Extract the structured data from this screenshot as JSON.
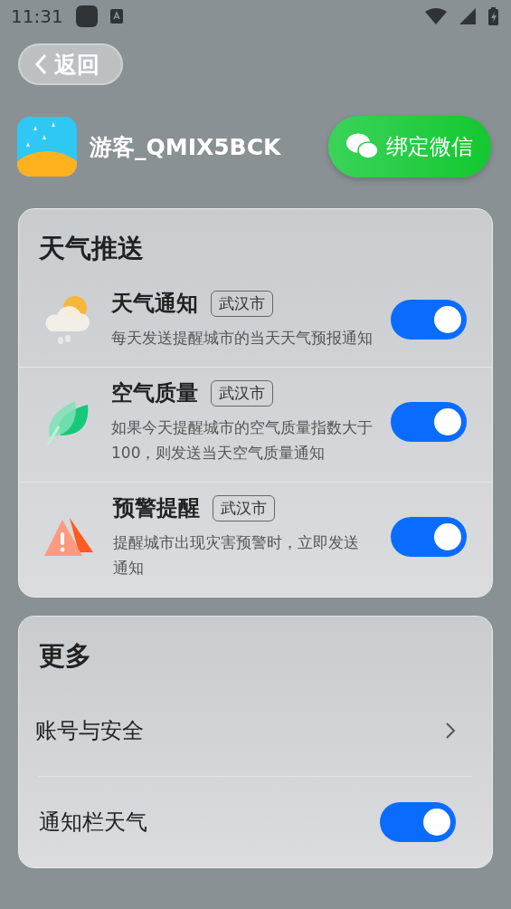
{
  "status_bar": {
    "time": "11:31"
  },
  "back_button": {
    "label": "返回"
  },
  "profile": {
    "name": "游客_QMIX5BCK",
    "bind_button": "绑定微信"
  },
  "weather_push": {
    "title": "天气推送",
    "items": [
      {
        "kind": "weather",
        "title": "天气通知",
        "city": "武汉市",
        "description": "每天发送提醒城市的当天天气预报通知",
        "on": true
      },
      {
        "kind": "air",
        "title": "空气质量",
        "city": "武汉市",
        "description": "如果今天提醒城市的空气质量指数大于100，则发送当天空气质量通知",
        "on": true
      },
      {
        "kind": "alert",
        "title": "预警提醒",
        "city": "武汉市",
        "description": "提醒城市出现灾害预警时，立即发送通知",
        "on": true
      }
    ]
  },
  "more": {
    "title": "更多",
    "items": [
      {
        "kind": "link",
        "label": "账号与安全"
      },
      {
        "kind": "toggle",
        "label": "通知栏天气",
        "on": true
      }
    ]
  }
}
